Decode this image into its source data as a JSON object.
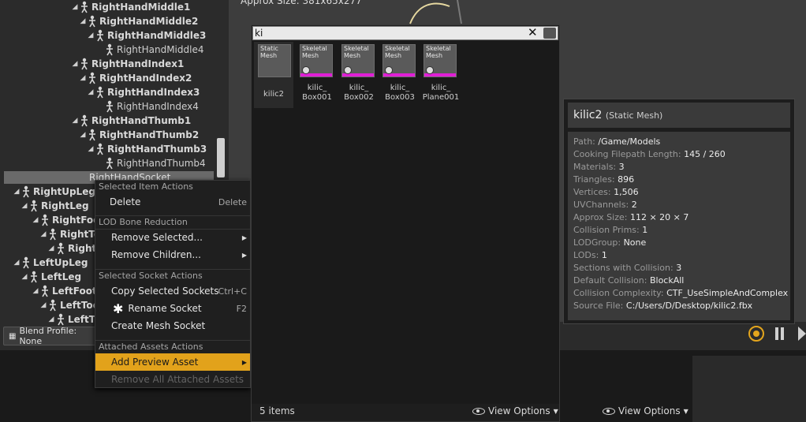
{
  "viewport": {
    "approx_size_text": "Approx Size: 381x65x277"
  },
  "tree": {
    "rows": [
      {
        "label": "RightHandMiddle1",
        "leaf": false
      },
      {
        "label": "RightHandMiddle2",
        "leaf": false
      },
      {
        "label": "RightHandMiddle3",
        "leaf": false
      },
      {
        "label": "RightHandMiddle4",
        "leaf": true
      },
      {
        "label": "RightHandIndex1",
        "leaf": false
      },
      {
        "label": "RightHandIndex2",
        "leaf": false
      },
      {
        "label": "RightHandIndex3",
        "leaf": false
      },
      {
        "label": "RightHandIndex4",
        "leaf": true
      },
      {
        "label": "RightHandThumb1",
        "leaf": false
      },
      {
        "label": "RightHandThumb2",
        "leaf": false
      },
      {
        "label": "RightHandThumb3",
        "leaf": false
      },
      {
        "label": "RightHandThumb4",
        "leaf": true
      },
      {
        "label": "RightUpLeg",
        "leaf": false
      },
      {
        "label": "RightLeg",
        "leaf": false
      },
      {
        "label": "RightFoot",
        "leaf": false
      },
      {
        "label": "RightToe",
        "leaf": false
      },
      {
        "label": "RightTo",
        "leaf": false
      },
      {
        "label": "LeftUpLeg",
        "leaf": false
      },
      {
        "label": "LeftLeg",
        "leaf": false
      },
      {
        "label": "LeftFoot",
        "leaf": false
      },
      {
        "label": "LeftToeB",
        "leaf": false
      },
      {
        "label": "LeftTo",
        "leaf": false
      }
    ],
    "selected_socket": "RightHandSocket",
    "blend_profile": "Blend Profile: None"
  },
  "context_menu": {
    "sec_item": "Selected Item Actions",
    "delete": "Delete",
    "delete_sc": "Delete",
    "sec_lod": "LOD Bone Reduction",
    "remove_selected": "Remove Selected...",
    "remove_children": "Remove Children...",
    "sec_socket": "Selected Socket Actions",
    "copy_sockets": "Copy Selected Sockets",
    "copy_sc": "Ctrl+C",
    "rename_socket": "Rename Socket",
    "rename_sc": "F2",
    "create_socket": "Create Mesh Socket",
    "sec_attached": "Attached Assets Actions",
    "add_preview": "Add Preview Asset",
    "remove_all": "Remove All Attached Assets"
  },
  "picker": {
    "search_value": "ki",
    "tiles": [
      {
        "thumb_label": "Static Mesh",
        "name": "kilic2"
      },
      {
        "thumb_label": "Skeletal Mesh",
        "name": "kilic_ Box001"
      },
      {
        "thumb_label": "Skeletal Mesh",
        "name": "kilic_ Box002"
      },
      {
        "thumb_label": "Skeletal Mesh",
        "name": "kilic_ Box003"
      },
      {
        "thumb_label": "Skeletal Mesh",
        "name": "kilic_ Plane001"
      }
    ],
    "count": "5 items",
    "view_options": "View Options"
  },
  "tooltip": {
    "title": "kilic2",
    "subtitle": "(Static Mesh)",
    "props": [
      {
        "k": "Path:",
        "v": "/Game/Models"
      },
      {
        "k": "Cooking Filepath Length:",
        "v": "145 / 260"
      },
      {
        "k": "Materials:",
        "v": "3"
      },
      {
        "k": "Triangles:",
        "v": "896"
      },
      {
        "k": "Vertices:",
        "v": "1,506"
      },
      {
        "k": "UVChannels:",
        "v": "2"
      },
      {
        "k": "Approx Size:",
        "v": "112 × 20 × 7"
      },
      {
        "k": "Collision Prims:",
        "v": "1"
      },
      {
        "k": "LODGroup:",
        "v": "None"
      },
      {
        "k": "LODs:",
        "v": "1"
      },
      {
        "k": "Sections with Collision:",
        "v": "3"
      },
      {
        "k": "Default Collision:",
        "v": "BlockAll"
      },
      {
        "k": "Collision Complexity:",
        "v": "CTF_UseSimpleAndComplex"
      },
      {
        "k": "Source File:",
        "v": "C:/Users/D/Desktop/kilic2.fbx"
      }
    ]
  },
  "right_view_options": "View Options",
  "colors": {
    "accent": "#e2a21b",
    "magenta": "#e01fd6"
  }
}
